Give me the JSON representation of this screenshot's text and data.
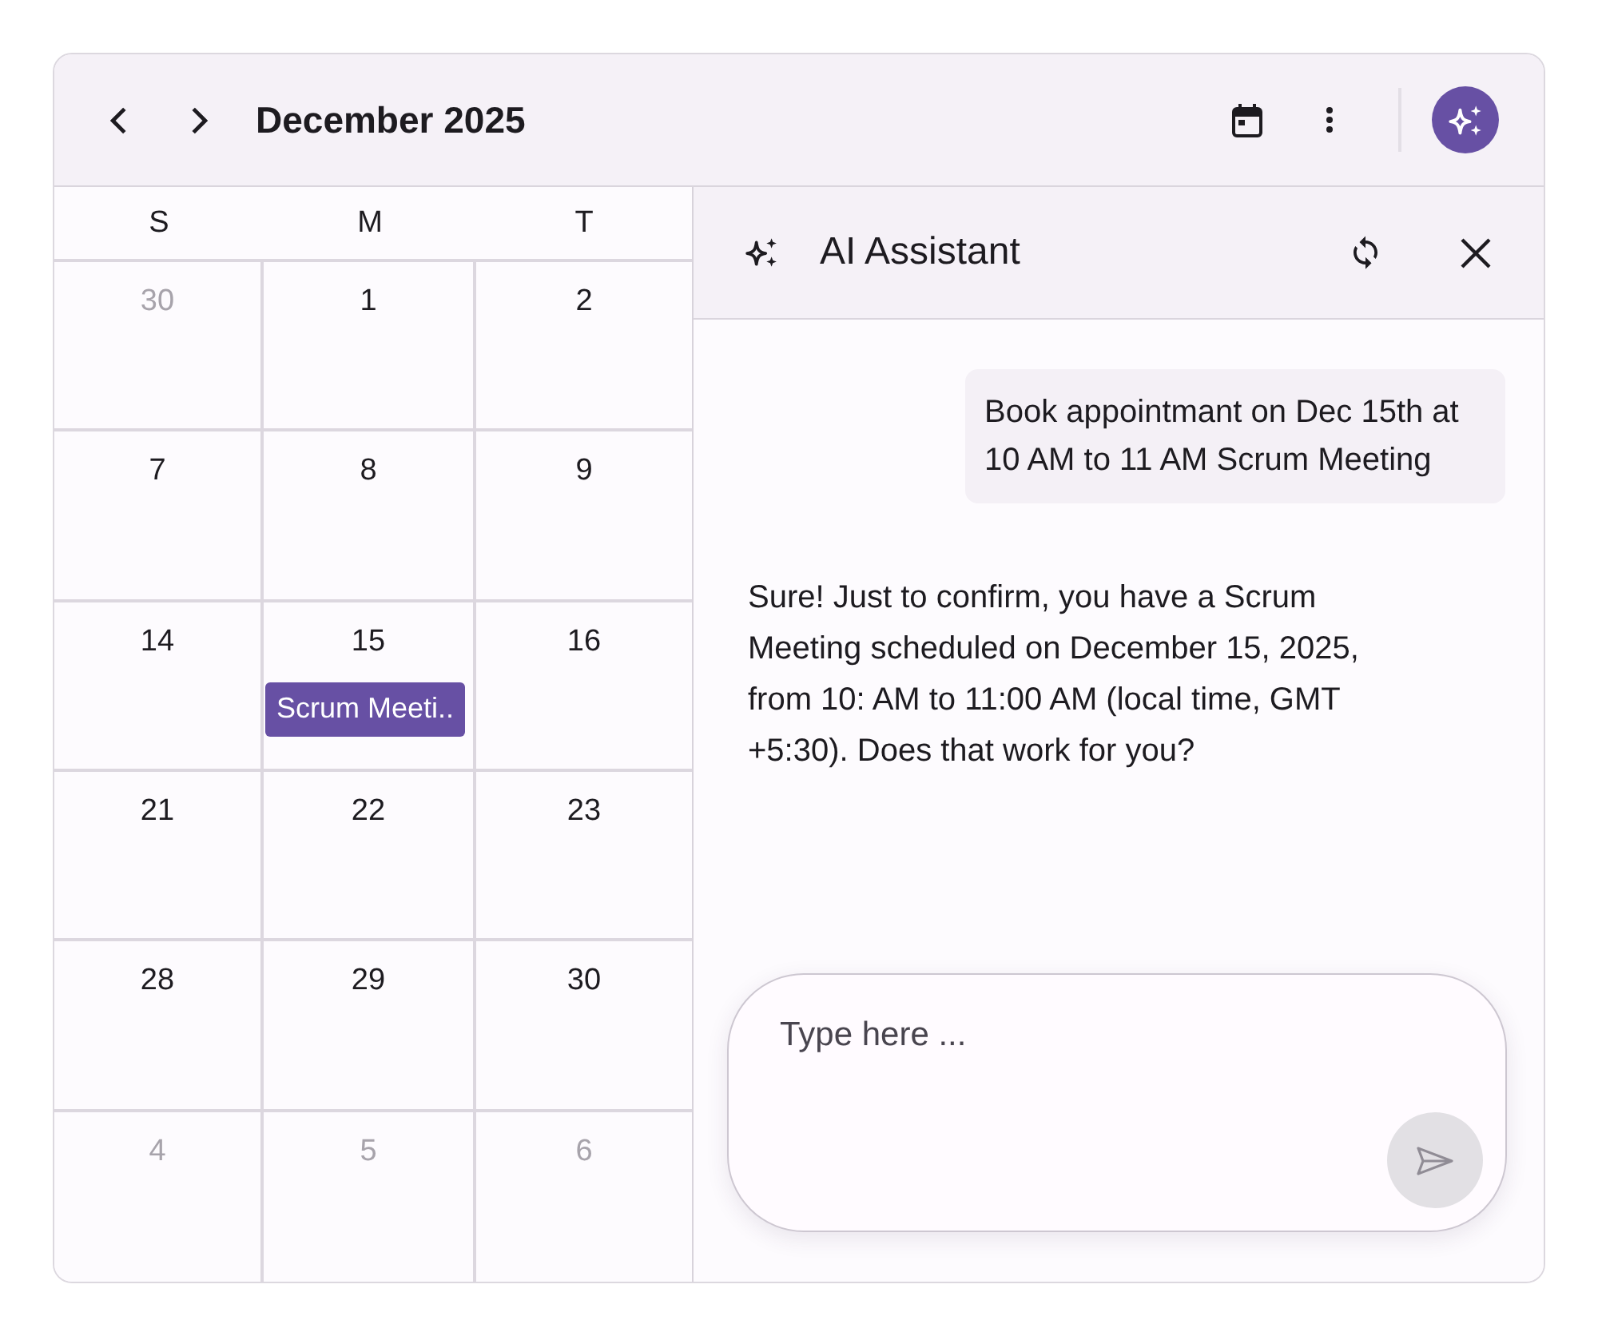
{
  "toolbar": {
    "title": "December 2025"
  },
  "calendar": {
    "weekdays": [
      "S",
      "M",
      "T"
    ],
    "weeks": [
      {
        "days": [
          {
            "date": "30",
            "outside_month": true
          },
          {
            "date": "1",
            "outside_month": false
          },
          {
            "date": "2",
            "outside_month": false
          }
        ]
      },
      {
        "days": [
          {
            "date": "7",
            "outside_month": false
          },
          {
            "date": "8",
            "outside_month": false
          },
          {
            "date": "9",
            "outside_month": false
          }
        ]
      },
      {
        "days": [
          {
            "date": "14",
            "outside_month": false
          },
          {
            "date": "15",
            "outside_month": false,
            "events": [
              {
                "title": "Scrum Meeti.."
              }
            ]
          },
          {
            "date": "16",
            "outside_month": false
          }
        ]
      },
      {
        "days": [
          {
            "date": "21",
            "outside_month": false
          },
          {
            "date": "22",
            "outside_month": false
          },
          {
            "date": "23",
            "outside_month": false
          }
        ]
      },
      {
        "days": [
          {
            "date": "28",
            "outside_month": false
          },
          {
            "date": "29",
            "outside_month": false
          },
          {
            "date": "30",
            "outside_month": false
          }
        ]
      },
      {
        "days": [
          {
            "date": "4",
            "outside_month": true
          },
          {
            "date": "5",
            "outside_month": true
          },
          {
            "date": "6",
            "outside_month": true
          }
        ]
      }
    ]
  },
  "assistant": {
    "title": "AI Assistant",
    "messages": [
      {
        "kind": "user",
        "text": "Book appointmant on Dec 15th at 10 AM to 11 AM Scrum Meeting"
      },
      {
        "kind": "assistant",
        "text": "Sure! Just to confirm, you have a Scrum Meeting scheduled on December 15, 2025, from 10: AM to 11:00 AM (local time, GMT +5:30). Does that work for you?"
      }
    ],
    "composer": {
      "placeholder": "Type here ..."
    }
  }
}
